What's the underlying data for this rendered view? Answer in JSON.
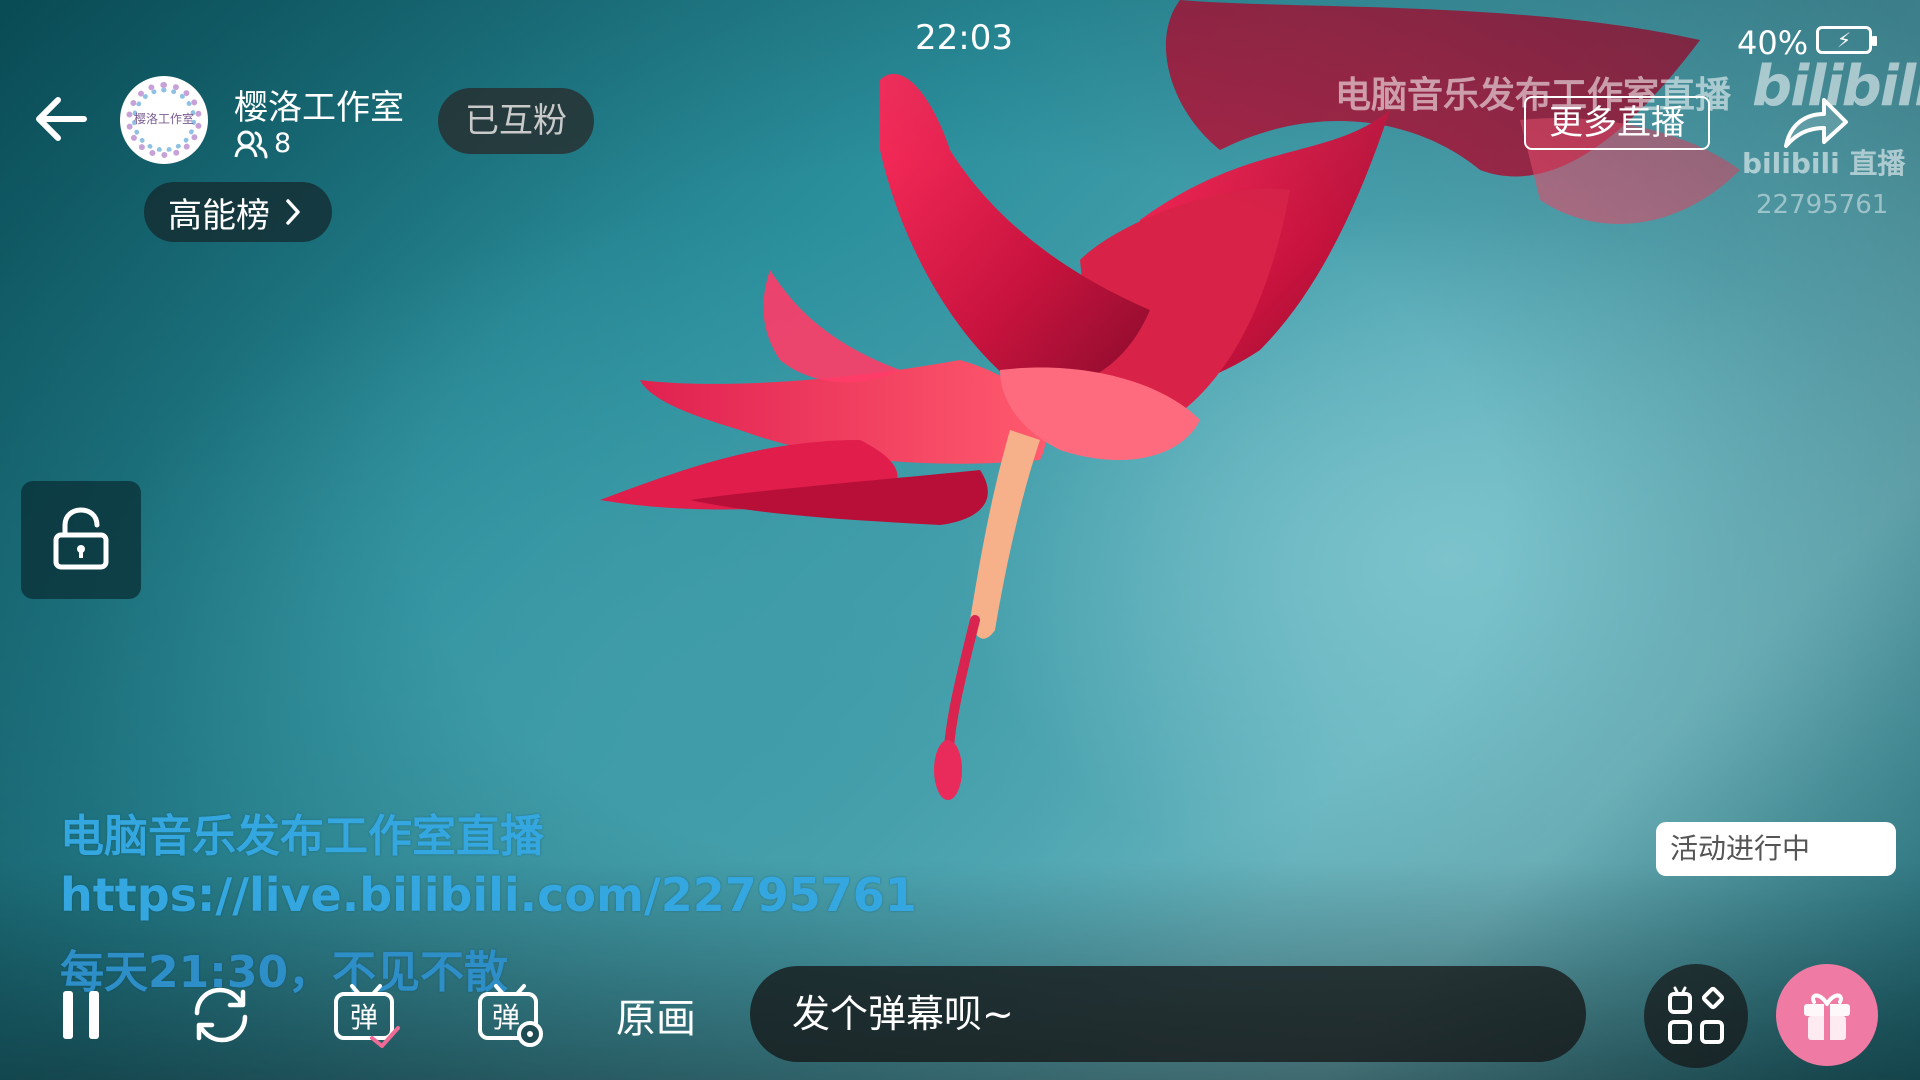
{
  "status_bar": {
    "time": "22:03",
    "battery": "40%"
  },
  "header": {
    "streamer_name": "樱洛工作室",
    "avatar_text": "樱洛工作室",
    "fans_count": "8",
    "follow_button": "已互粉",
    "rank_button": "高能榜"
  },
  "top_right": {
    "watermark_title": "电脑音乐发布工作室直播",
    "more_live": "更多直播",
    "logo_text": "bilibili",
    "logo_sub": "bilibili 直播",
    "room_id": "22795761"
  },
  "overlay": {
    "line1": "电脑音乐发布工作室直播",
    "line2": "https://live.bilibili.com/22795761",
    "line3": "每天21:30，不见不散"
  },
  "activity": "活动进行中",
  "controls": {
    "quality": "原画",
    "danmu_placeholder": "发个弹幕呗~"
  },
  "icons": {
    "back": "arrow-left-icon",
    "fans": "people-icon",
    "rank_chevron": "chevron-right-icon",
    "share": "share-icon",
    "lock": "unlock-icon",
    "pause": "pause-icon",
    "refresh": "refresh-icon",
    "danmu_toggle": "danmu-icon",
    "danmu_settings": "danmu-settings-icon",
    "menu": "grid-menu-icon",
    "gift": "gift-icon"
  },
  "colors": {
    "overlay_text": "#35a7e0",
    "gift": "#ef7aa3"
  }
}
